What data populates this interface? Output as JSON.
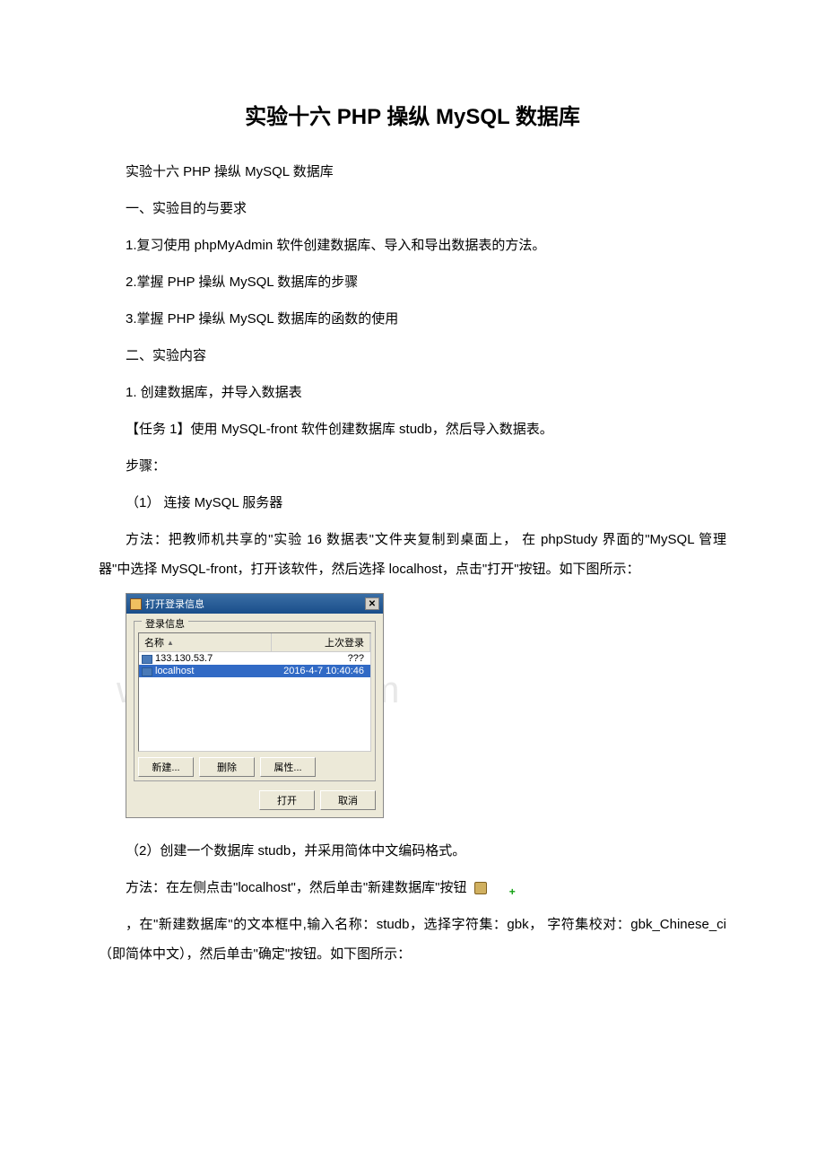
{
  "title": "实验十六 PHP 操纵 MySQL 数据库",
  "subtitle": "实验十六 PHP 操纵 MySQL 数据库",
  "section1_heading": "一、实验目的与要求",
  "section1_item1": "1.复习使用 phpMyAdmin 软件创建数据库、导入和导出数据表的方法。",
  "section1_item2": "2.掌握 PHP 操纵 MySQL 数据库的步骤",
  "section1_item3": "3.掌握 PHP 操纵 MySQL 数据库的函数的使用",
  "section2_heading": "二、实验内容",
  "section2_item1": "1. 创建数据库，并导入数据表",
  "task1": "【任务 1】使用 MySQL-front 软件创建数据库 studb，然后导入数据表。",
  "steps_label": "步骤：",
  "step1": "（1） 连接 MySQL 服务器",
  "step1_method": "方法：把教师机共享的\"实验 16 数据表\"文件夹复制到桌面上， 在 phpStudy 界面的\"MySQL 管理器\"中选择 MySQL-front，打开该软件，然后选择 localhost，点击\"打开\"按钮。如下图所示：",
  "step2": "（2）创建一个数据库 studb，并采用简体中文编码格式。",
  "step2_method": "方法：在左侧点击\"localhost\"，然后单击\"新建数据库\"按钮",
  "step2_detail": "，在\"新建数据库\"的文本框中,输入名称：studb，选择字符集：gbk， 字符集校对：gbk_Chinese_ci（即简体中文），然后单击\"确定\"按钮。如下图所示：",
  "watermark": "www.bdocx.com",
  "dialog": {
    "title": "打开登录信息",
    "fieldset_label": "登录信息",
    "col_name": "名称",
    "col_login": "上次登录",
    "rows": [
      {
        "name": "133.130.53.7",
        "login": "???"
      },
      {
        "name": "localhost",
        "login": "2016-4-7 10:40:46"
      }
    ],
    "btn_new": "新建...",
    "btn_delete": "删除",
    "btn_props": "属性...",
    "btn_open": "打开",
    "btn_cancel": "取消"
  }
}
